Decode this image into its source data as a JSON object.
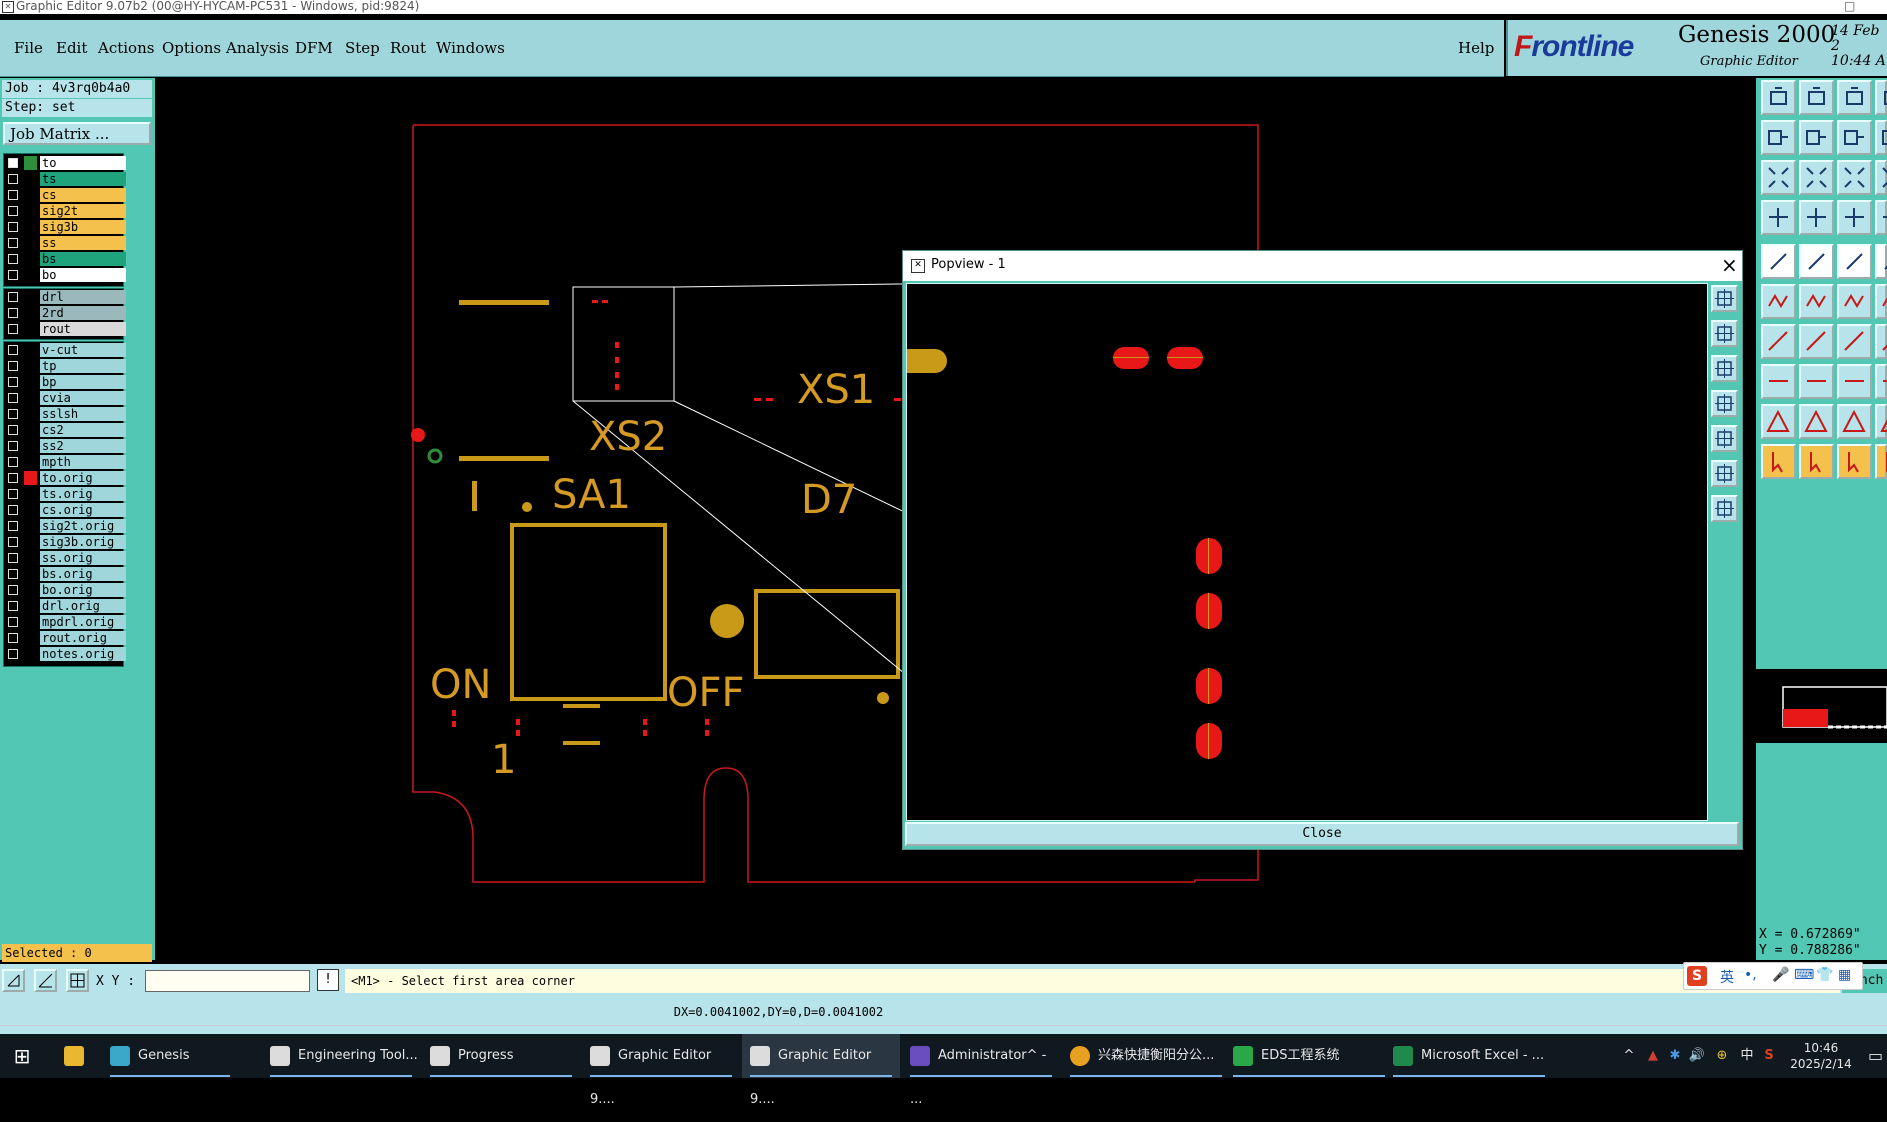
{
  "window": {
    "title": "Graphic Editor 9.07b2 (00@HY-HYCAM-PC531 - Windows, pid:9824)"
  },
  "menu": {
    "items": [
      "File",
      "Edit",
      "Actions",
      "Options",
      "Analysis",
      "DFM",
      "Step",
      "Rout",
      "Windows"
    ],
    "help": "Help"
  },
  "brand": {
    "frontline_a": "F",
    "frontline_b": "rontline",
    "product": "Genesis 2000",
    "subtitle": "Graphic Editor",
    "date": "14 Feb 2",
    "time": "10:44 A"
  },
  "job": {
    "job": "Job : 4v3rq0b4a0",
    "step": "Step: set",
    "matrix_button": "Job Matrix ..."
  },
  "layers_group1": [
    {
      "name": "to",
      "color": "#ffffff",
      "swatch": "#2d8f3a",
      "checked": true
    },
    {
      "name": "ts",
      "color": "#1fa37c",
      "swatch": "#000000",
      "checked": false
    },
    {
      "name": "cs",
      "color": "#f4c24c",
      "swatch": "#000000",
      "checked": false
    },
    {
      "name": "sig2t",
      "color": "#f4c24c",
      "swatch": "#000000",
      "checked": false
    },
    {
      "name": "sig3b",
      "color": "#f4c24c",
      "swatch": "#000000",
      "checked": false
    },
    {
      "name": "ss",
      "color": "#f4c24c",
      "swatch": "#000000",
      "checked": false
    },
    {
      "name": "bs",
      "color": "#1fa37c",
      "swatch": "#000000",
      "checked": false
    },
    {
      "name": "bo",
      "color": "#ffffff",
      "swatch": "#000000",
      "checked": false
    }
  ],
  "layers_group2": [
    {
      "name": "drl",
      "color": "#9bb8bd",
      "swatch": "#000000"
    },
    {
      "name": "2rd",
      "color": "#9bb8bd",
      "swatch": "#000000"
    },
    {
      "name": "rout",
      "color": "#d9d9d9",
      "swatch": "#000000"
    }
  ],
  "layers_group3": [
    {
      "name": "v-cut",
      "color": "#9fd6dc",
      "swatch": "#000000"
    },
    {
      "name": "tp",
      "color": "#9fd6dc",
      "swatch": "#000000"
    },
    {
      "name": "bp",
      "color": "#9fd6dc",
      "swatch": "#000000"
    },
    {
      "name": "cvia",
      "color": "#9fd6dc",
      "swatch": "#000000"
    },
    {
      "name": "sslsh",
      "color": "#9fd6dc",
      "swatch": "#000000"
    },
    {
      "name": "cs2",
      "color": "#9fd6dc",
      "swatch": "#000000"
    },
    {
      "name": "ss2",
      "color": "#9fd6dc",
      "swatch": "#000000"
    },
    {
      "name": "mpth",
      "color": "#9fd6dc",
      "swatch": "#000000"
    },
    {
      "name": "to.orig",
      "color": "#9fd6dc",
      "swatch": "#e81818"
    },
    {
      "name": "ts.orig",
      "color": "#9fd6dc",
      "swatch": "#000000"
    },
    {
      "name": "cs.orig",
      "color": "#9fd6dc",
      "swatch": "#000000"
    },
    {
      "name": "sig2t.orig",
      "color": "#9fd6dc",
      "swatch": "#000000"
    },
    {
      "name": "sig3b.orig",
      "color": "#9fd6dc",
      "swatch": "#000000"
    },
    {
      "name": "ss.orig",
      "color": "#9fd6dc",
      "swatch": "#000000"
    },
    {
      "name": "bs.orig",
      "color": "#9fd6dc",
      "swatch": "#000000"
    },
    {
      "name": "bo.orig",
      "color": "#9fd6dc",
      "swatch": "#000000"
    },
    {
      "name": "drl.orig",
      "color": "#9fd6dc",
      "swatch": "#000000"
    },
    {
      "name": "mpdrl.orig",
      "color": "#9fd6dc",
      "swatch": "#000000"
    },
    {
      "name": "rout.orig",
      "color": "#9fd6dc",
      "swatch": "#000000"
    },
    {
      "name": "notes.orig",
      "color": "#9fd6dc",
      "swatch": "#000000"
    }
  ],
  "selected": "Selected : 0",
  "canvas_labels": {
    "xs2": "XS2",
    "xs1": "XS1",
    "sa1": "SA1",
    "d7": "D7",
    "on": "ON",
    "off": "OFF",
    "one": "1",
    "bar": "I"
  },
  "popup": {
    "title": "Popview - 1",
    "close_label": "Close"
  },
  "coords": {
    "x": "X = 0.672869\"",
    "y": "Y = 0.788286\""
  },
  "bottom": {
    "xy_label": "X Y :",
    "bang": "!",
    "prompt": "<M1> - Select first area corner",
    "units": "Inch",
    "delta": "DX=0.0041002,DY=0,D=0.0041002"
  },
  "ime": {
    "lang": "英",
    "punct": "•,"
  },
  "taskbar": {
    "items": [
      "Genesis",
      "Engineering Tool...",
      "Progress",
      "Graphic Editor 9....",
      "Graphic Editor 9....",
      "Administrator^ - ...",
      "兴森快捷衡阳分公...",
      "EDS工程系统",
      "Microsoft Excel - ..."
    ],
    "tray_ime": "中",
    "time": "10:46",
    "date": "2025/2/14"
  },
  "colors": {
    "panel": "#52c8b4",
    "menubar": "#9fd6dc",
    "feature_yellow": "#c89a18",
    "pad_red": "#e81818",
    "outline_red": "#c8191e"
  }
}
